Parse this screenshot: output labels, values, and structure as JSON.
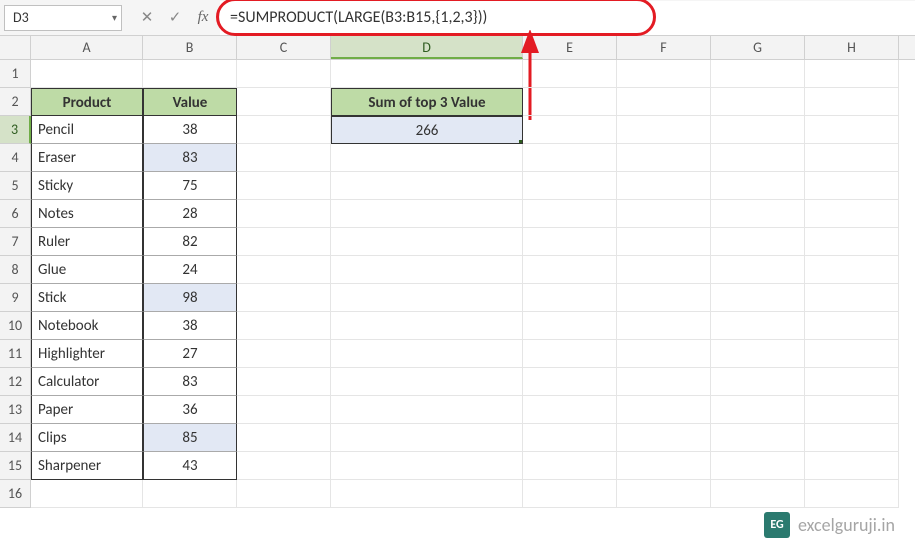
{
  "name_box": "D3",
  "formula_bar": "=SUMPRODUCT(LARGE(B3:B15,{1,2,3}))",
  "columns": [
    "A",
    "B",
    "C",
    "D",
    "E",
    "F",
    "G",
    "H"
  ],
  "selected_column_index": 3,
  "selected_row": 3,
  "table": {
    "headers": {
      "product": "Product",
      "value": "Value"
    },
    "rows": [
      {
        "product": "Pencil",
        "value": 38,
        "hl": false
      },
      {
        "product": "Eraser",
        "value": 83,
        "hl": true
      },
      {
        "product": "Sticky",
        "value": 75,
        "hl": false
      },
      {
        "product": "Notes",
        "value": 28,
        "hl": false
      },
      {
        "product": "Ruler",
        "value": 82,
        "hl": false
      },
      {
        "product": "Glue",
        "value": 24,
        "hl": false
      },
      {
        "product": "Stick",
        "value": 98,
        "hl": true
      },
      {
        "product": "Notebook",
        "value": 38,
        "hl": false
      },
      {
        "product": "Highlighter",
        "value": 27,
        "hl": false
      },
      {
        "product": "Calculator",
        "value": 83,
        "hl": false
      },
      {
        "product": "Paper",
        "value": 36,
        "hl": false
      },
      {
        "product": "Clips",
        "value": 85,
        "hl": true
      },
      {
        "product": "Sharpener",
        "value": 43,
        "hl": false
      }
    ]
  },
  "result": {
    "header": "Sum of top 3 Value",
    "value": 266
  },
  "watermark": {
    "badge": "EG",
    "text": "excelguruji.in"
  },
  "colors": {
    "header_fill": "#bedba6",
    "highlight_fill": "#e2e8f4",
    "annotation": "#e31b23",
    "selection": "#2e5c1f"
  },
  "col_widths": {
    "A": 112,
    "B": 94,
    "C": 94,
    "D": 192,
    "E": 94,
    "F": 94,
    "G": 94,
    "H": 94
  }
}
